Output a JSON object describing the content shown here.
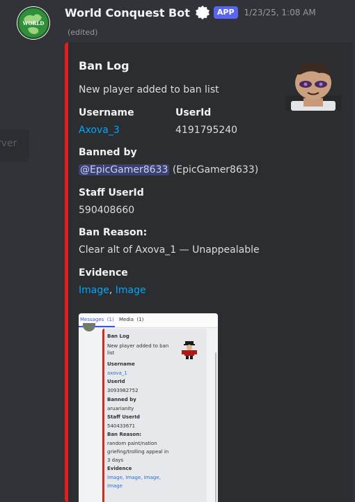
{
  "background_ghost_text": "rver",
  "message": {
    "author": "World Conquest Bot",
    "app_badge": "APP",
    "timestamp": "1/23/25, 1:08 AM",
    "edited": "(edited)",
    "avatar_icon": "world-conquest-globe-icon",
    "accent_color": "#e01e1e",
    "link_color": "#00a8fc"
  },
  "embed": {
    "title": "Ban Log",
    "description": "New player added to ban list",
    "fields": {
      "username_name": "Username",
      "username_value": "Axova_3",
      "userid_name": "UserId",
      "userid_value": "4191795240",
      "banned_by_name": "Banned by",
      "banned_by_mention": "@EpicGamer8633",
      "banned_by_extra": "(EpicGamer8633)",
      "staff_userid_name": "Staff UserId",
      "staff_userid_value": "590408660",
      "ban_reason_name": "Ban Reason:",
      "ban_reason_value": "Clear alt of Axova_1 — Unappealable",
      "evidence_name": "Evidence",
      "evidence_link_1": "Image",
      "evidence_sep": ", ",
      "evidence_link_2": "Image"
    }
  },
  "preview": {
    "tab_messages": "Messages",
    "tab_messages_count": "(1)",
    "tab_media": "Media",
    "tab_media_count": "(1)",
    "title": "Ban Log",
    "desc_1": "New player added to ban",
    "desc_2": "list",
    "username_name": "Username",
    "username_value": "axova_1",
    "userid_name": "UserId",
    "userid_value": "3093982752",
    "banned_by_name": "Banned by",
    "banned_by_value": "aruarianity",
    "staff_userid_name": "Staff UserId",
    "staff_userid_value": "540433671",
    "ban_reason_name": "Ban Reason:",
    "reason_1": "random paint/nation",
    "reason_2": "griefing/trolling appeal in",
    "reason_3": "3 days",
    "evidence_name": "Evidence",
    "evidence_line_1": "Image,  Image,  Image,",
    "evidence_line_2": "Image"
  }
}
